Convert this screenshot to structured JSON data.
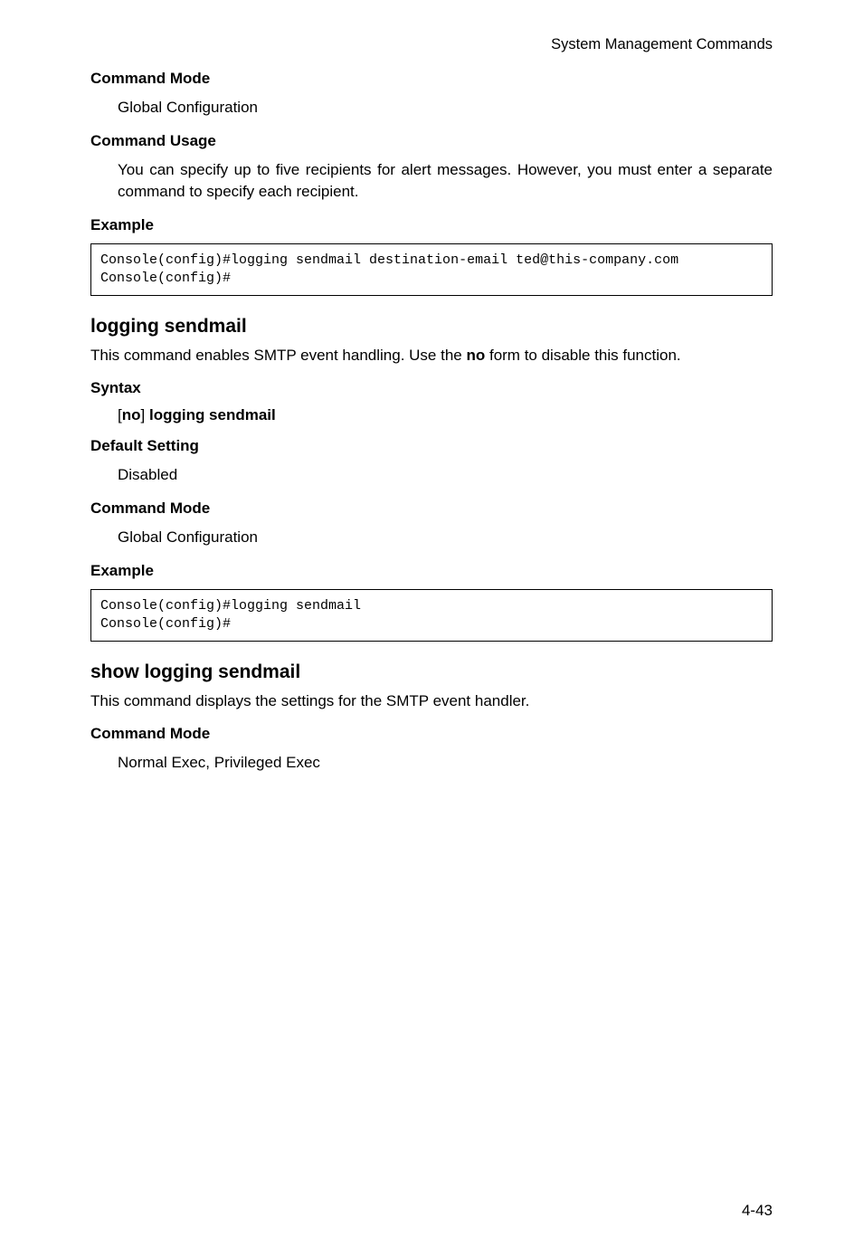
{
  "header": {
    "right": "System Management Commands"
  },
  "section1": {
    "commandModeHeading": "Command Mode",
    "commandModeText": "Global Configuration",
    "commandUsageHeading": "Command Usage",
    "commandUsageText": "You can specify up to five recipients for alert messages. However, you must enter a separate command to specify each recipient.",
    "exampleHeading": "Example",
    "exampleCode": "Console(config)#logging sendmail destination-email ted@this-company.com\nConsole(config)#"
  },
  "section2": {
    "title": "logging sendmail",
    "descriptionPrefix": "This command enables SMTP event handling. Use the ",
    "descriptionBold": "no",
    "descriptionSuffix": " form to disable this function.",
    "syntaxHeading": "Syntax",
    "syntaxBracketOpen": "[",
    "syntaxNo": "no",
    "syntaxBracketClose": "] ",
    "syntaxCommand": "logging sendmail",
    "defaultSettingHeading": "Default Setting",
    "defaultSettingText": "Disabled",
    "commandModeHeading": "Command Mode",
    "commandModeText": "Global Configuration",
    "exampleHeading": "Example",
    "exampleCode": "Console(config)#logging sendmail\nConsole(config)#"
  },
  "section3": {
    "title": "show logging sendmail",
    "description": "This command displays the settings for the SMTP event handler.",
    "commandModeHeading": "Command Mode",
    "commandModeText": "Normal Exec, Privileged Exec"
  },
  "footer": {
    "pageNumber": "4-43"
  }
}
